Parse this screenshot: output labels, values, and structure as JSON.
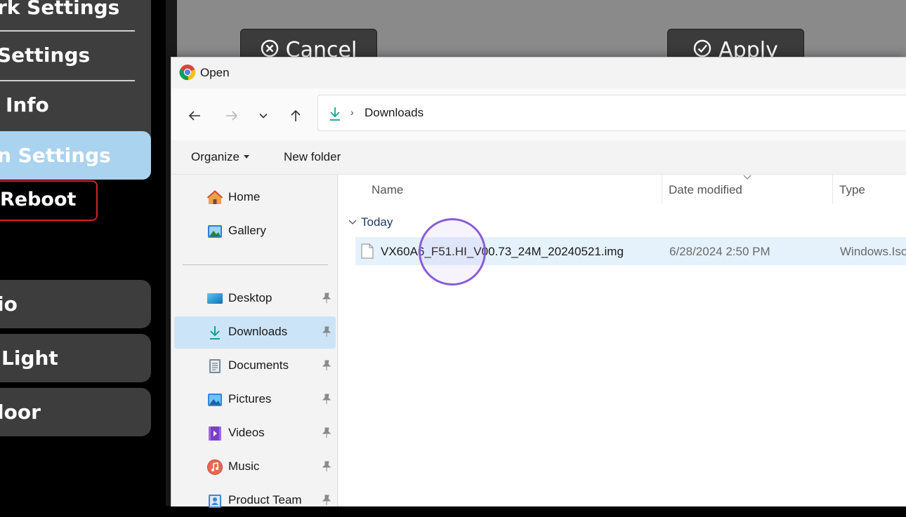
{
  "background_app": {
    "sidebar_items": [
      {
        "label": "rk Settings"
      },
      {
        "label": "Settings"
      },
      {
        "label": "Info"
      },
      {
        "label": "n Settings"
      }
    ],
    "reboot_label": "Reboot",
    "cards": [
      {
        "label": "io"
      },
      {
        "label": "Light"
      },
      {
        "label": "loor"
      }
    ],
    "buttons": {
      "cancel": "Cancel",
      "apply": "Apply"
    },
    "highlight_color": "#a9d3ef",
    "reboot_border_color": "#d4202a"
  },
  "dialog": {
    "title": "Open",
    "title_icon": "chrome-icon",
    "address": {
      "location": "Downloads",
      "icon": "download-arrow-icon"
    },
    "commands": {
      "organize": "Organize",
      "new_folder": "New folder"
    },
    "nav_items": [
      {
        "label": "Home",
        "icon": "home-icon"
      },
      {
        "label": "Gallery",
        "icon": "gallery-icon"
      },
      {
        "label": "Desktop",
        "icon": "desktop-icon",
        "pinned": true
      },
      {
        "label": "Downloads",
        "icon": "downloads-icon",
        "pinned": true,
        "selected": true
      },
      {
        "label": "Documents",
        "icon": "documents-icon",
        "pinned": true
      },
      {
        "label": "Pictures",
        "icon": "pictures-icon",
        "pinned": true
      },
      {
        "label": "Videos",
        "icon": "videos-icon",
        "pinned": true
      },
      {
        "label": "Music",
        "icon": "music-icon",
        "pinned": true
      },
      {
        "label": "Product Team",
        "icon": "contact-icon",
        "pinned": true
      }
    ],
    "columns": {
      "name": "Name",
      "date_modified": "Date modified",
      "type": "Type"
    },
    "group": "Today",
    "files": [
      {
        "name": "VX60A6_F51.HI_V00.73_24M_20240521.img",
        "date_modified": "6/28/2024 2:50 PM",
        "type": "Windows.Iso"
      }
    ],
    "selection_color": "#cce4f7",
    "row_hover_color": "#e5f1fb"
  }
}
